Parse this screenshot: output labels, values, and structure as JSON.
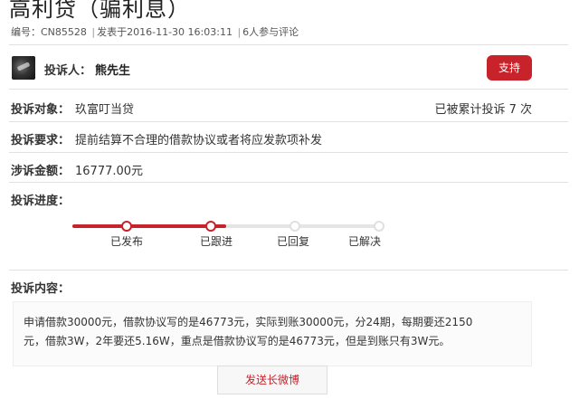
{
  "header": {
    "title": "高利贷（骗利息）",
    "code_label": "编号：",
    "code_value": "CN85528",
    "published_label": "发表于",
    "published_time": "2016-11-30 16:03:11",
    "comment_count_text": "6人参与评论"
  },
  "complainant": {
    "label": "投诉人：",
    "name": "熊先生",
    "support_button": "支持"
  },
  "complaint": {
    "target_label": "投诉对象：",
    "target_value": "玖富叮当贷",
    "cumulative_text": "已被累计投诉 7 次",
    "request_label": "投诉要求：",
    "request_value": "提前结算不合理的借款协议或者将应发款项补发",
    "amount_label": "涉诉金额：",
    "amount_value": "16777.00元",
    "progress_label": "投诉进度：",
    "progress_fraction": 0.5,
    "steps": [
      {
        "label": "已发布",
        "done": true
      },
      {
        "label": "已跟进",
        "done": true
      },
      {
        "label": "已回复",
        "done": false
      },
      {
        "label": "已解决",
        "done": false
      }
    ],
    "content_label": "投诉内容：",
    "content_line1": "申请借款30000元，借款协议写的是46773元，实际到账30000元，分24期，每期要还2150",
    "content_line2": "元，借款3W，2年要还5.16W，重点是借款协议写的是46773元，但是到账只有3W元。"
  },
  "share_button": "发送长微博",
  "colors": {
    "accent": "#c8222b",
    "track": "#e5e5e5",
    "text": "#333333"
  }
}
